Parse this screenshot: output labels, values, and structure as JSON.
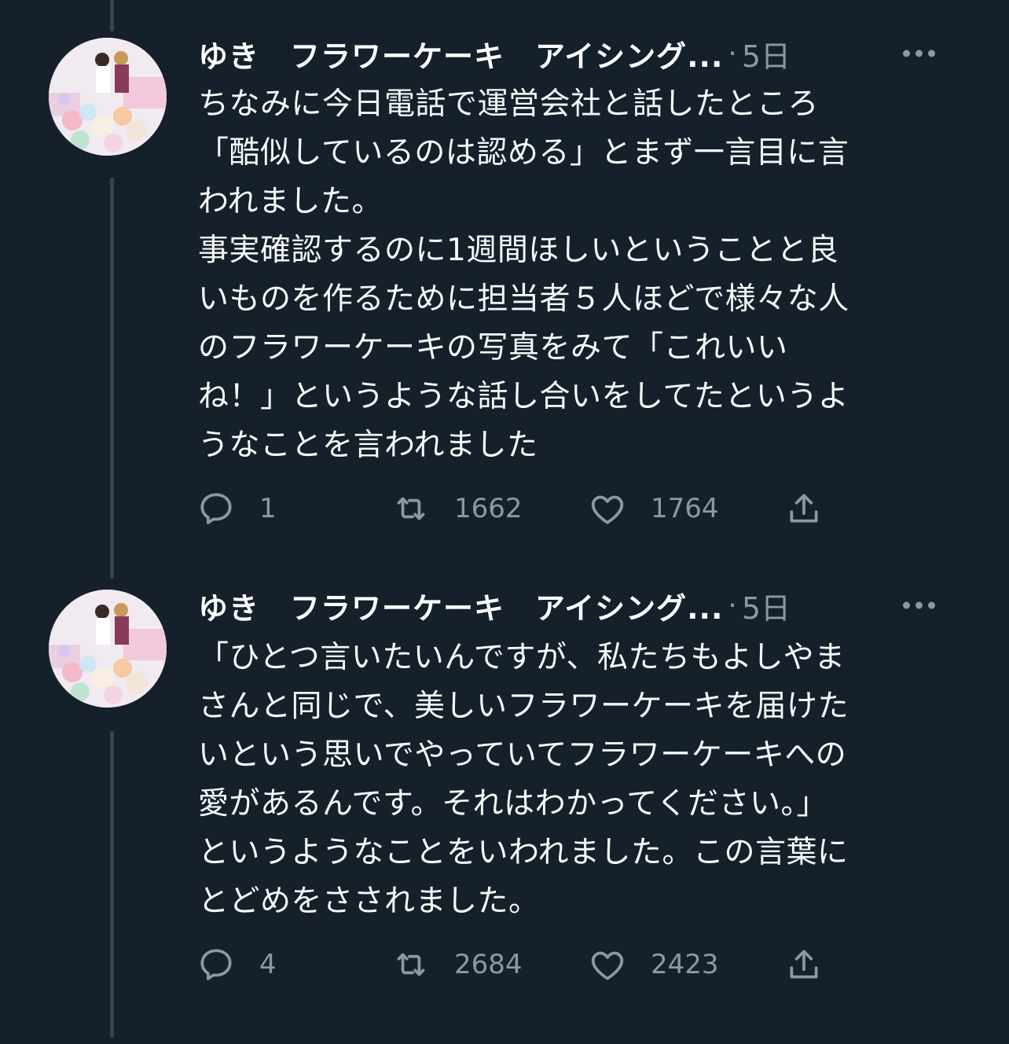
{
  "tweets": [
    {
      "author_name": "ゆき　フラワーケーキ　アイシング...",
      "separator": "·",
      "time": "5日",
      "text": "ちなみに今日電話で運営会社と話したところ\n「酷似しているのは認める」とまず一言目に言\nわれました。\n事実確認するのに1週間ほしいということと良\nいものを作るために担当者５人ほどで様々な人\nのフラワーケーキの写真をみて「これいい\nね！」というような話し合いをしてたというよ\nうなことを言われました",
      "reply_count": "1",
      "retweet_count": "1662",
      "like_count": "1764"
    },
    {
      "author_name": "ゆき　フラワーケーキ　アイシング...",
      "separator": "·",
      "time": "5日",
      "text": "「ひとつ言いたいんですが、私たちもよしやま\nさんと同じで、美しいフラワーケーキを届けた\nいという思いでやっていてフラワーケーキへの\n愛があるんです。それはわかってください。」\nというようなことをいわれました。この言葉に\nとどめをさされました。",
      "reply_count": "4",
      "retweet_count": "2684",
      "like_count": "2423"
    }
  ],
  "icons": {
    "reply": "reply-icon",
    "retweet": "retweet-icon",
    "like": "heart-icon",
    "share": "share-icon",
    "more": "more-icon"
  },
  "colors": {
    "background": "#15202b",
    "secondary_text": "#8b98a5",
    "thread_line": "#38444d"
  }
}
